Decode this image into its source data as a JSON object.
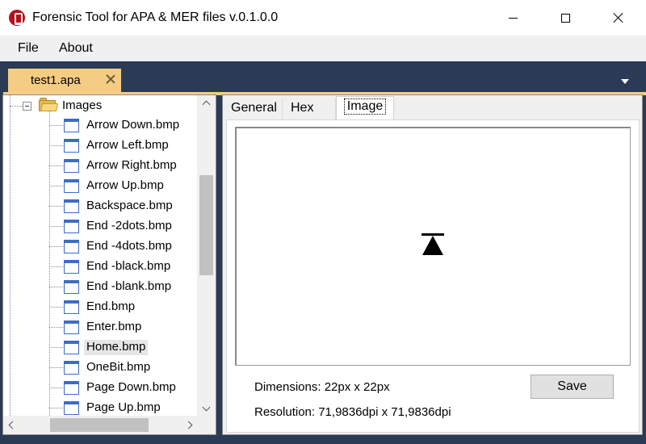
{
  "window": {
    "title": "Forensic Tool for APA & MER files v.0.1.0.0"
  },
  "menu": {
    "file": "File",
    "about": "About"
  },
  "document_tab": {
    "label": "test1.apa"
  },
  "tree": {
    "root_label": "Images",
    "items": [
      {
        "label": "Arrow Down.bmp"
      },
      {
        "label": "Arrow Left.bmp"
      },
      {
        "label": "Arrow Right.bmp"
      },
      {
        "label": "Arrow Up.bmp"
      },
      {
        "label": "Backspace.bmp"
      },
      {
        "label": "End -2dots.bmp"
      },
      {
        "label": "End -4dots.bmp"
      },
      {
        "label": "End -black.bmp"
      },
      {
        "label": "End -blank.bmp"
      },
      {
        "label": "End.bmp"
      },
      {
        "label": "Enter.bmp"
      },
      {
        "label": "Home.bmp"
      },
      {
        "label": "OneBit.bmp"
      },
      {
        "label": "Page Down.bmp"
      },
      {
        "label": "Page Up.bmp"
      }
    ],
    "selected_item": "Home.bmp"
  },
  "panel": {
    "tabs": [
      {
        "label": "General"
      },
      {
        "label": "Hex"
      },
      {
        "label": "Image"
      }
    ],
    "active_tab": "Image",
    "dimensions": "Dimensions: 22px x 22px",
    "resolution": "Resolution: 71,9836dpi x 71,9836dpi",
    "save_label": "Save"
  },
  "colors": {
    "app_icon": "#b3111c",
    "doc_background": "#2b3a55",
    "doc_tab": "#f5cc84",
    "file_icon": "#3e6cc3",
    "folder": "#e4b74a"
  }
}
